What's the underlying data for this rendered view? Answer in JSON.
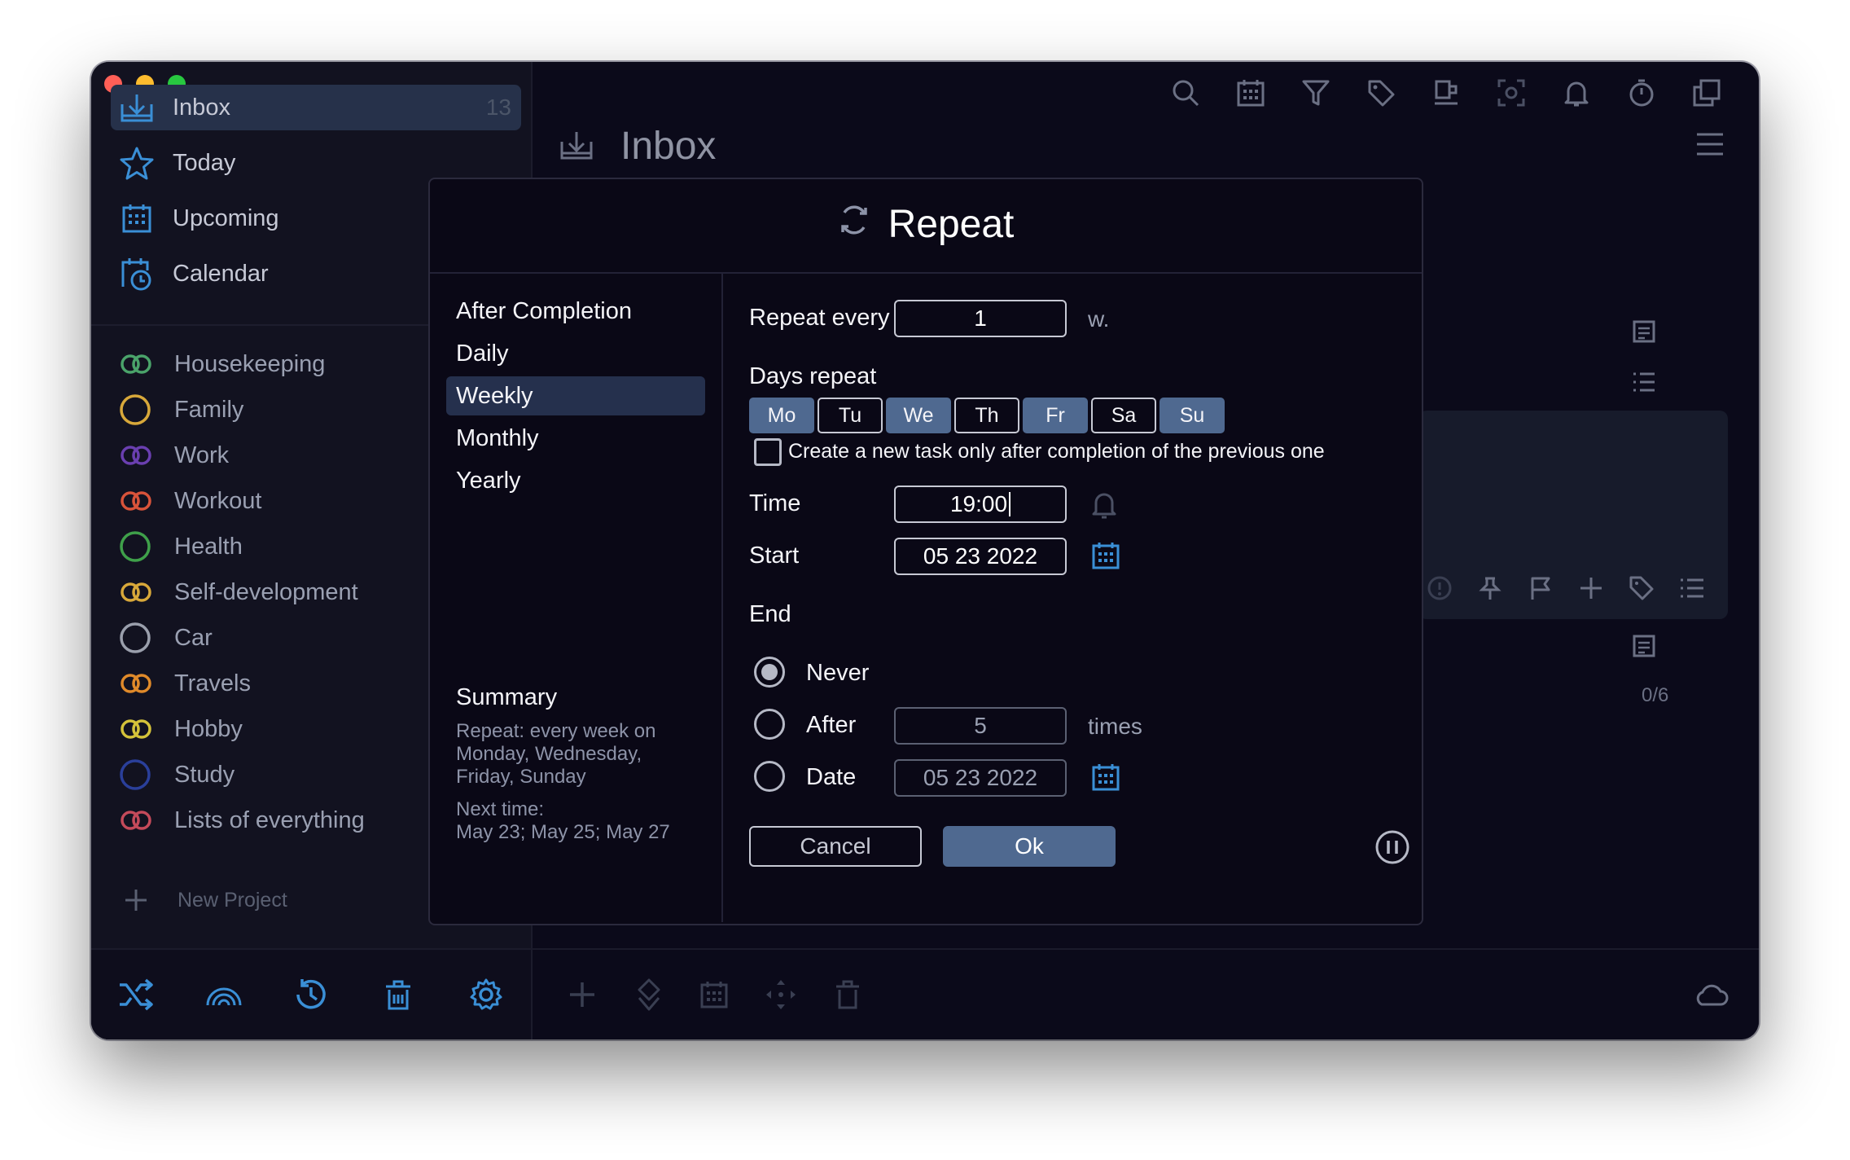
{
  "colors": {
    "accent": "#4f6990",
    "accent_icon": "#3a8fd6",
    "window_bg": "#0b0a1a",
    "sidebar_bg": "#121220",
    "dialog_bg": "#0a0816",
    "active_row": "#25304d"
  },
  "sidebar": {
    "nav": [
      {
        "label": "Inbox",
        "count": "13",
        "icon": "inbox-icon",
        "active": true
      },
      {
        "label": "Today",
        "icon": "star-icon"
      },
      {
        "label": "Upcoming",
        "icon": "calendar-grid-icon"
      },
      {
        "label": "Calendar",
        "icon": "calendar-clock-icon"
      }
    ],
    "projects": [
      {
        "label": "Housekeeping",
        "color": "#4aa36a",
        "icon": "double-ring-icon"
      },
      {
        "label": "Family",
        "color": "#d8a83a",
        "icon": "ring-icon"
      },
      {
        "label": "Work",
        "color": "#6a3fb0",
        "icon": "double-ring-icon"
      },
      {
        "label": "Workout",
        "color": "#d8533a",
        "icon": "double-ring-icon"
      },
      {
        "label": "Health",
        "color": "#3fa04a",
        "icon": "ring-icon"
      },
      {
        "label": "Self-development",
        "color": "#d8a83a",
        "icon": "double-ring-icon"
      },
      {
        "label": "Car",
        "color": "#9a9fac",
        "icon": "ring-icon"
      },
      {
        "label": "Travels",
        "color": "#e08a2a",
        "icon": "double-ring-icon"
      },
      {
        "label": "Hobby",
        "color": "#d4c23a",
        "icon": "double-ring-icon"
      },
      {
        "label": "Study",
        "color": "#2a3f9a",
        "icon": "ring-icon"
      },
      {
        "label": "Lists of everything",
        "color": "#c44a5a",
        "icon": "double-ring-icon"
      }
    ],
    "new_project": "New Project"
  },
  "main": {
    "title": "Inbox",
    "counter": "0/6"
  },
  "dialog": {
    "title": "Repeat",
    "types": [
      "After Completion",
      "Daily",
      "Weekly",
      "Monthly",
      "Yearly"
    ],
    "selected_type": "Weekly",
    "repeat_every_label": "Repeat every",
    "repeat_every_value": "1",
    "repeat_every_unit": "w.",
    "days_repeat_label": "Days repeat",
    "days": [
      {
        "label": "Mo",
        "on": true
      },
      {
        "label": "Tu",
        "on": false
      },
      {
        "label": "We",
        "on": true
      },
      {
        "label": "Th",
        "on": false
      },
      {
        "label": "Fr",
        "on": true
      },
      {
        "label": "Sa",
        "on": false
      },
      {
        "label": "Su",
        "on": true
      }
    ],
    "checkbox_label": "Create a new task only after completion of the previous one",
    "checkbox_checked": false,
    "time_label": "Time",
    "time_value": "19:00",
    "start_label": "Start",
    "start_value": "05 23 2022",
    "end_label": "End",
    "end_options": {
      "never": "Never",
      "after": "After",
      "date": "Date"
    },
    "end_selected": "Never",
    "after_value": "5",
    "after_unit": "times",
    "date_value": "05 23 2022",
    "summary_title": "Summary",
    "summary_text": "Repeat: every week on Monday, Wednesday, Friday, Sunday",
    "next_time_label": "Next time:",
    "next_time_value": "May 23; May 25; May 27",
    "cancel_label": "Cancel",
    "ok_label": "Ok"
  }
}
